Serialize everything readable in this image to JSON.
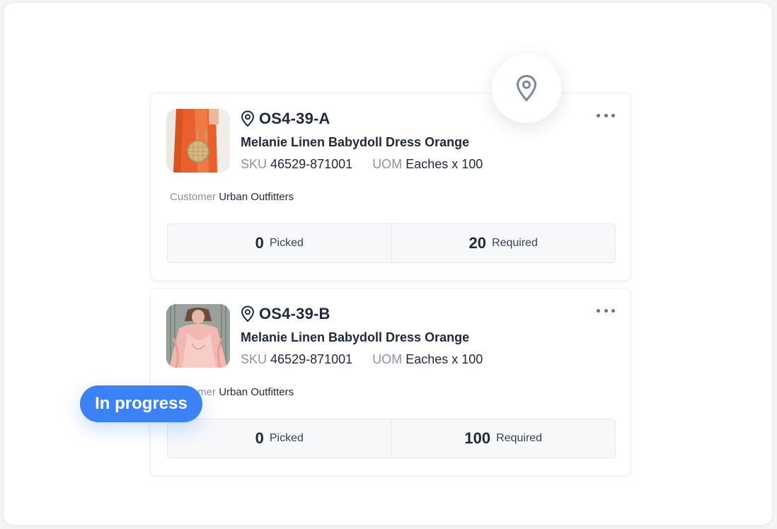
{
  "cards": [
    {
      "location_code": "OS4-39-A",
      "product_name": "Melanie Linen Babydoll Dress Orange",
      "sku_label": "SKU",
      "sku_value": "46529-871001",
      "uom_label": "UOM",
      "uom_value": "Eaches x 100",
      "customer_label": "Customer",
      "customer_value": "Urban Outfitters",
      "picked_value": "0",
      "picked_label": "Picked",
      "required_value": "20",
      "required_label": "Required"
    },
    {
      "location_code": "OS4-39-B",
      "product_name": "Melanie Linen Babydoll Dress Orange",
      "sku_label": "SKU",
      "sku_value": "46529-871001",
      "uom_label": "UOM",
      "uom_value": "Eaches x 100",
      "customer_label": "Customer",
      "customer_value": "Urban Outfitters",
      "picked_value": "0",
      "picked_label": "Picked",
      "required_value": "100",
      "required_label": "Required"
    }
  ],
  "status_badge": "In progress",
  "icons": {
    "location": "map-pin-icon",
    "more": "more-horizontal-icon"
  },
  "colors": {
    "accent": "#3b82f6",
    "text_primary": "#1f2937",
    "text_muted": "#8b93a1"
  }
}
